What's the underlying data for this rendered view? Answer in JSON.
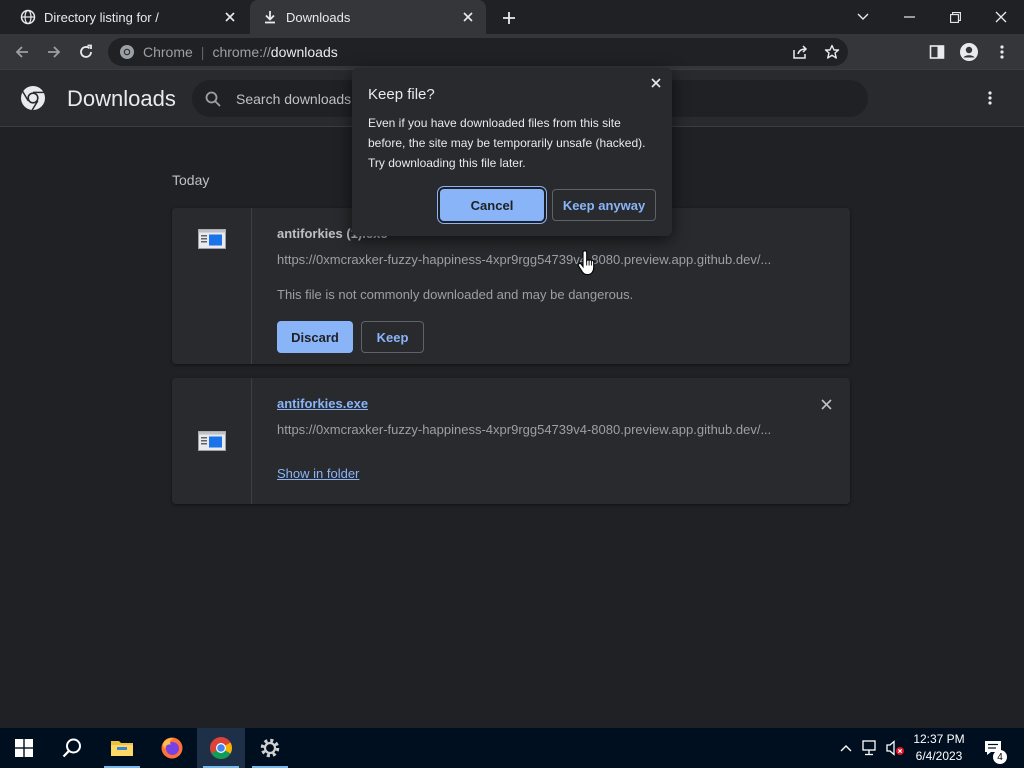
{
  "browser": {
    "tabs": [
      {
        "label": "Directory listing for /",
        "active": false
      },
      {
        "label": "Downloads",
        "active": true
      }
    ],
    "omnibox": {
      "chip": "Chrome",
      "url_prefix": "chrome://",
      "url_path": "downloads"
    }
  },
  "downloads_page": {
    "title": "Downloads",
    "search_placeholder": "Search downloads",
    "section_label": "Today",
    "items": [
      {
        "name": "antiforkies (1).exe",
        "url": "https://0xmcraxker-fuzzy-happiness-4xpr9rgg54739v4-8080.preview.app.github.dev/...",
        "warning": "This file is not commonly downloaded and may be dangerous.",
        "discard_label": "Discard",
        "keep_label": "Keep"
      },
      {
        "name": "antiforkies.exe",
        "url": "https://0xmcraxker-fuzzy-happiness-4xpr9rgg54739v4-8080.preview.app.github.dev/...",
        "show_in_folder_label": "Show in folder"
      }
    ]
  },
  "dialog": {
    "title": "Keep file?",
    "body": "Even if you have downloaded files from this site before, the site may be temporarily unsafe (hacked). Try downloading this file later.",
    "cancel_label": "Cancel",
    "keep_anyway_label": "Keep anyway"
  },
  "taskbar": {
    "time": "12:37 PM",
    "date": "6/4/2023",
    "notification_count": "4"
  },
  "colors": {
    "accent": "#8ab4f8",
    "background": "#202124",
    "surface": "#292a2d"
  }
}
